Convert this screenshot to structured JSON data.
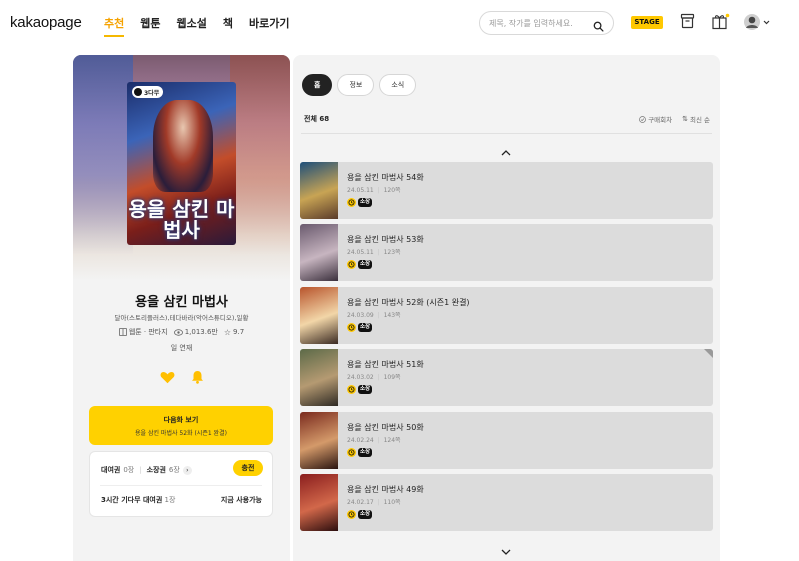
{
  "header": {
    "logo": "kakaopage",
    "nav": [
      "추천",
      "웹툰",
      "웹소설",
      "책",
      "바로가기"
    ],
    "search_placeholder": "제목, 작가를 입력하세요.",
    "stage_label": "STAGE",
    "colors": {
      "accent": "#f5a200",
      "stage_bg": "#ffc800"
    }
  },
  "series": {
    "badge": "3다무",
    "cover_title": "용을 삼킨 마법사",
    "title": "용을 삼킨 마법사",
    "authors": "달아(스토리플러스),테다바라(악어스튜디오),일황",
    "genre": "웹툰 · 판타지",
    "views": "1,013.6만",
    "rating": "9.7",
    "schedule": "일 연재"
  },
  "next_button": {
    "label": "다음화 보기",
    "sub": "용을 삼킨 마법사 52화 (시즌1 완결)"
  },
  "tickets": {
    "rental_label": "대여권",
    "rental_count": "0장",
    "owned_label": "소장권",
    "owned_count": "6장",
    "charge_label": "충전",
    "wait_label": "3시간 기다무 대여권",
    "wait_count": "1장",
    "wait_status": "지금 사용가능"
  },
  "tabs": [
    "홈",
    "정보",
    "소식"
  ],
  "list": {
    "total_label": "전체",
    "total": "68",
    "purchased_label": "구매회차",
    "sort_label": "최신 순"
  },
  "episodes": [
    {
      "title": "용을 삼킨 마법사 54화",
      "date": "24.05.11",
      "comments": "120쪽",
      "tag": "소장",
      "thumb_colors": [
        "#1e4f7a",
        "#c8a454",
        "#5a3b2a"
      ],
      "corner": false
    },
    {
      "title": "용을 삼킨 마법사 53화",
      "date": "24.05.11",
      "comments": "123쪽",
      "tag": "소장",
      "thumb_colors": [
        "#6a5a6e",
        "#c7b5c0",
        "#3a2f3c"
      ],
      "corner": false
    },
    {
      "title": "용을 삼킨 마법사 52화 (시즌1 완결)",
      "date": "24.03.09",
      "comments": "143쪽",
      "tag": "소장",
      "thumb_colors": [
        "#b8542c",
        "#f2d6a8",
        "#3a2a22"
      ],
      "corner": false
    },
    {
      "title": "용을 삼킨 마법사 51화",
      "date": "24.03.02",
      "comments": "109쪽",
      "tag": "소장",
      "thumb_colors": [
        "#5c6a48",
        "#b59a72",
        "#2e2a24"
      ],
      "corner": true
    },
    {
      "title": "용을 삼킨 마법사 50화",
      "date": "24.02.24",
      "comments": "124쪽",
      "tag": "소장",
      "thumb_colors": [
        "#7a2a1e",
        "#d49a6a",
        "#2a1410"
      ],
      "corner": false
    },
    {
      "title": "용을 삼킨 마법사 49화",
      "date": "24.02.17",
      "comments": "110쪽",
      "tag": "소장",
      "thumb_colors": [
        "#8a1e1e",
        "#d2684a",
        "#2c0e0e"
      ],
      "corner": false
    }
  ]
}
